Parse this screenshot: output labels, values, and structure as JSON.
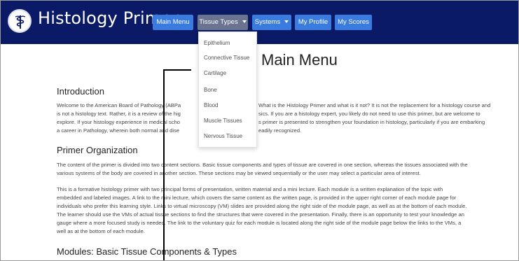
{
  "brand": {
    "title": "Histology Primer"
  },
  "nav": {
    "main_menu": "Main Menu",
    "tissue_types": "Tissue Types",
    "systems": "Systems",
    "my_profile": "My Profile",
    "my_scores": "My Scores"
  },
  "dropdown": {
    "items": [
      "Epithelium",
      "Connective Tissue",
      "Cartilage",
      "Bone",
      "Blood",
      "Muscle Tissues",
      "Nervous Tissue"
    ]
  },
  "page": {
    "title": "Main Menu",
    "intro": {
      "heading": "Introduction",
      "left_lines": [
        "Welcome to the American Board of Pathology (ABPa",
        "is not a histology text. Rather, it is a review of the hig",
        "explore. If your histology experience in medical scho",
        "a career in Pathology, wherein both normal and dise"
      ],
      "right_lines": [
        "What is the Histology Primer and what is it not? It is not the replacement for a histology course and",
        "sics. If you are a histology expert, you likely do not need to use this primer, but are welcome to",
        "s primer is presented to strengthen your foundation in histology, particularly if you are embarking",
        "eadily recognized."
      ]
    },
    "organization": {
      "heading": "Primer Organization",
      "para1": [
        "The content of the primer is divided into two content sections. Basic tissue components and types of tissue are covered in one section, whereas the tissues associated with the",
        "various systems of the body are covered in another section. These sections may be viewed sequentially or the user may select a particular area of interest."
      ],
      "para2": [
        "This is a formative histology primer with two principal forms of presentation, written material and a mini lecture. Each module is a written explanation of the topic with",
        "embedded and labeled images. A link to the mini lecture, which covers the same content as the written page, is provided in the upper right corner of each module page for",
        "individuals who prefer this learning style. Links to virtual microscopy (VM) slides are provided along the right side of the module page, as well as at the bottom of each module.",
        "The learner should use the VMs of actual tissue sections to find the structures that were covered in the presentation. Finally, there is an opportunity to test your knowledge an",
        "gauge where a more focused study is needed. The link to the voluntary quiz for each module is located along the right side of the module page below the links to the VMs, a",
        "well as at the bottom of each module."
      ]
    },
    "modules": {
      "heading": "Modules: Basic Tissue Components & Types"
    }
  },
  "colors": {
    "navbar": "#0b1a66",
    "button": "#3a7be0",
    "button_active": "#6a7390"
  }
}
